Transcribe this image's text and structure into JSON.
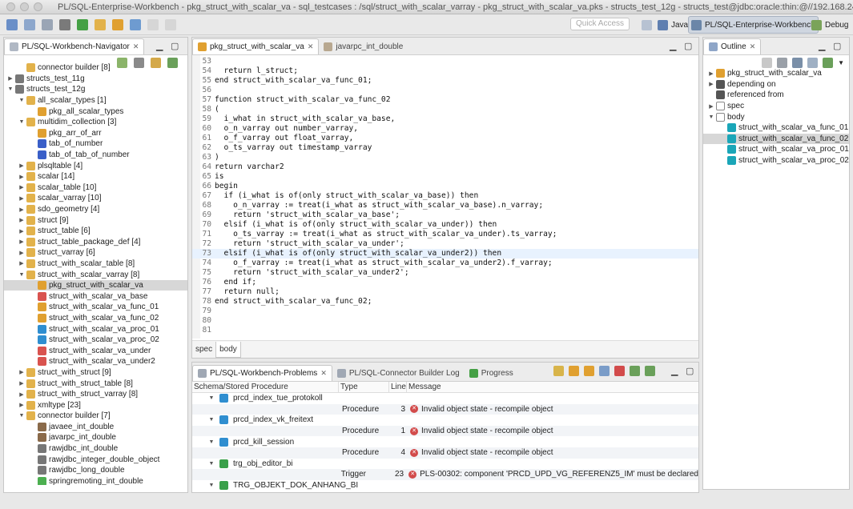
{
  "window": {
    "title": "PL/SQL-Enterprise-Workbench - pkg_struct_with_scalar_va - sql_testcases : /sql/struct_with_scalar_varray - pkg_struct_with_scalar_va.pks - structs_test_12g - structs_test@jdbc:oracle:thin:@//192.168.243..."
  },
  "toolbar": {
    "quick_access": "Quick Access",
    "perspectives": [
      {
        "label": "Java"
      },
      {
        "label": "PL/SQL-Enterprise-Workbench"
      },
      {
        "label": "Debug"
      }
    ]
  },
  "navigator": {
    "title": "PL/SQL-Workbench-Navigator",
    "rows": [
      {
        "label": "connector builder [8]",
        "indent": 2,
        "twisty": "",
        "icon": "folder-icon",
        "color": "#e2b24b"
      },
      {
        "label": "structs_test_11g",
        "indent": 1,
        "twisty": "▶",
        "icon": "database-icon",
        "color": "#777777"
      },
      {
        "label": "structs_test_12g",
        "indent": 1,
        "twisty": "▼",
        "icon": "database-icon",
        "color": "#777777"
      },
      {
        "label": "all_scalar_types [1]",
        "indent": 2,
        "twisty": "▼",
        "icon": "folder-icon",
        "color": "#e2b24b"
      },
      {
        "label": "pkg_all_scalar_types",
        "indent": 3,
        "twisty": "",
        "icon": "package-icon",
        "color": "#e0a030"
      },
      {
        "label": "multidim_collection [3]",
        "indent": 2,
        "twisty": "▼",
        "icon": "folder-icon",
        "color": "#e2b24b"
      },
      {
        "label": "pkg_arr_of_arr",
        "indent": 3,
        "twisty": "",
        "icon": "package-icon",
        "color": "#e0a030"
      },
      {
        "label": "tab_of_number",
        "indent": 3,
        "twisty": "",
        "icon": "type-icon",
        "color": "#3a5fc8"
      },
      {
        "label": "tab_of_tab_of_number",
        "indent": 3,
        "twisty": "",
        "icon": "type-icon",
        "color": "#3a5fc8"
      },
      {
        "label": "plsqltable [4]",
        "indent": 2,
        "twisty": "▶",
        "icon": "folder-icon",
        "color": "#e2b24b"
      },
      {
        "label": "scalar [14]",
        "indent": 2,
        "twisty": "▶",
        "icon": "folder-icon",
        "color": "#e2b24b"
      },
      {
        "label": "scalar_table [10]",
        "indent": 2,
        "twisty": "▶",
        "icon": "folder-icon",
        "color": "#e2b24b"
      },
      {
        "label": "scalar_varray [10]",
        "indent": 2,
        "twisty": "▶",
        "icon": "folder-icon",
        "color": "#e2b24b"
      },
      {
        "label": "sdo_geometry [4]",
        "indent": 2,
        "twisty": "▶",
        "icon": "folder-icon",
        "color": "#e2b24b"
      },
      {
        "label": "struct [9]",
        "indent": 2,
        "twisty": "▶",
        "icon": "folder-icon",
        "color": "#e2b24b"
      },
      {
        "label": "struct_table [6]",
        "indent": 2,
        "twisty": "▶",
        "icon": "folder-icon",
        "color": "#e2b24b"
      },
      {
        "label": "struct_table_package_def [4]",
        "indent": 2,
        "twisty": "▶",
        "icon": "folder-icon",
        "color": "#e2b24b"
      },
      {
        "label": "struct_varray [6]",
        "indent": 2,
        "twisty": "▶",
        "icon": "folder-icon",
        "color": "#e2b24b"
      },
      {
        "label": "struct_with_scalar_table [8]",
        "indent": 2,
        "twisty": "▶",
        "icon": "folder-icon",
        "color": "#e2b24b"
      },
      {
        "label": "struct_with_scalar_varray [8]",
        "indent": 2,
        "twisty": "▼",
        "icon": "folder-icon",
        "color": "#e2b24b"
      },
      {
        "label": "pkg_struct_with_scalar_va",
        "indent": 3,
        "twisty": "",
        "icon": "package-icon",
        "color": "#e0a030",
        "selected": true
      },
      {
        "label": "struct_with_scalar_va_base",
        "indent": 3,
        "twisty": "",
        "icon": "object-type-icon",
        "color": "#d9534f"
      },
      {
        "label": "struct_with_scalar_va_func_01",
        "indent": 3,
        "twisty": "",
        "icon": "function-icon",
        "color": "#e0a030"
      },
      {
        "label": "struct_with_scalar_va_func_02",
        "indent": 3,
        "twisty": "",
        "icon": "function-icon",
        "color": "#e0a030"
      },
      {
        "label": "struct_with_scalar_va_proc_01",
        "indent": 3,
        "twisty": "",
        "icon": "procedure-icon",
        "color": "#2f8ed0"
      },
      {
        "label": "struct_with_scalar_va_proc_02",
        "indent": 3,
        "twisty": "",
        "icon": "procedure-icon",
        "color": "#2f8ed0"
      },
      {
        "label": "struct_with_scalar_va_under",
        "indent": 3,
        "twisty": "",
        "icon": "object-type-icon",
        "color": "#d9534f"
      },
      {
        "label": "struct_with_scalar_va_under2",
        "indent": 3,
        "twisty": "",
        "icon": "object-type-icon",
        "color": "#d9534f"
      },
      {
        "label": "struct_with_struct [9]",
        "indent": 2,
        "twisty": "▶",
        "icon": "folder-icon",
        "color": "#e2b24b"
      },
      {
        "label": "struct_with_struct_table [8]",
        "indent": 2,
        "twisty": "▶",
        "icon": "folder-icon",
        "color": "#e2b24b"
      },
      {
        "label": "struct_with_struct_varray [8]",
        "indent": 2,
        "twisty": "▶",
        "icon": "folder-icon",
        "color": "#e2b24b"
      },
      {
        "label": "xmltype [23]",
        "indent": 2,
        "twisty": "▶",
        "icon": "folder-icon",
        "color": "#e2b24b"
      },
      {
        "label": "connector builder [7]",
        "indent": 2,
        "twisty": "▼",
        "icon": "folder-icon",
        "color": "#e2b24b"
      },
      {
        "label": "javaee_int_double",
        "indent": 3,
        "twisty": "",
        "icon": "connector-icon",
        "color": "#8a6a4a"
      },
      {
        "label": "javarpc_int_double",
        "indent": 3,
        "twisty": "",
        "icon": "connector-icon",
        "color": "#8a6a4a"
      },
      {
        "label": "rawjdbc_int_double",
        "indent": 3,
        "twisty": "",
        "icon": "connector-icon",
        "color": "#777777"
      },
      {
        "label": "rawjdbc_integer_double_object",
        "indent": 3,
        "twisty": "",
        "icon": "connector-icon",
        "color": "#777777"
      },
      {
        "label": "rawjdbc_long_double",
        "indent": 3,
        "twisty": "",
        "icon": "connector-icon",
        "color": "#777777"
      },
      {
        "label": "springremoting_int_double",
        "indent": 3,
        "twisty": "",
        "icon": "connector-icon",
        "color": "#4caf50"
      }
    ]
  },
  "editor": {
    "tabs": [
      {
        "label": "pkg_struct_with_scalar_va",
        "active": true
      },
      {
        "label": "javarpc_int_double",
        "active": false
      }
    ],
    "bottom_tabs": [
      {
        "label": "spec"
      },
      {
        "label": "body"
      }
    ],
    "lines": [
      {
        "n": "53",
        "t": ""
      },
      {
        "n": "54",
        "t": "  return l_struct;"
      },
      {
        "n": "55",
        "t": "end struct_with_scalar_va_func_01;"
      },
      {
        "n": "56",
        "t": ""
      },
      {
        "n": "57",
        "t": "function struct_with_scalar_va_func_02"
      },
      {
        "n": "58",
        "t": "("
      },
      {
        "n": "59",
        "t": "  i_what in struct_with_scalar_va_base,"
      },
      {
        "n": "60",
        "t": "  o_n_varray out number_varray,"
      },
      {
        "n": "61",
        "t": "  o_f_varray out float_varray,"
      },
      {
        "n": "62",
        "t": "  o_ts_varray out timestamp_varray"
      },
      {
        "n": "63",
        "t": ")"
      },
      {
        "n": "64",
        "t": "return varchar2"
      },
      {
        "n": "65",
        "t": "is"
      },
      {
        "n": "66",
        "t": "begin"
      },
      {
        "n": "67",
        "t": "  if (i_what is of(only struct_with_scalar_va_base)) then"
      },
      {
        "n": "68",
        "t": "    o_n_varray := treat(i_what as struct_with_scalar_va_base).n_varray;"
      },
      {
        "n": "69",
        "t": "    return 'struct_with_scalar_va_base';"
      },
      {
        "n": "70",
        "t": "  elsif (i_what is of(only struct_with_scalar_va_under)) then"
      },
      {
        "n": "71",
        "t": "    o_ts_varray := treat(i_what as struct_with_scalar_va_under).ts_varray;"
      },
      {
        "n": "72",
        "t": "    return 'struct_with_scalar_va_under';"
      },
      {
        "n": "73",
        "t": "  elsif (i_what is of(only struct_with_scalar_va_under2)) then"
      },
      {
        "n": "74",
        "t": "    o_f_varray := treat(i_what as struct_with_scalar_va_under2).f_varray;"
      },
      {
        "n": "75",
        "t": "    return 'struct_with_scalar_va_under2';"
      },
      {
        "n": "76",
        "t": "  end if;"
      },
      {
        "n": "77",
        "t": "  return null;"
      },
      {
        "n": "78",
        "t": "end struct_with_scalar_va_func_02;"
      },
      {
        "n": "79",
        "t": ""
      },
      {
        "n": "80",
        "t": ""
      },
      {
        "n": "81",
        "t": ""
      }
    ]
  },
  "outline": {
    "title": "Outline",
    "rows": [
      {
        "label": "pkg_struct_with_scalar_va",
        "indent": 1,
        "twisty": "▶",
        "icon": "package-icon",
        "color": "#e0a030"
      },
      {
        "label": "depending on",
        "indent": 1,
        "twisty": "▶",
        "icon": "dependency-icon",
        "color": "#555555"
      },
      {
        "label": "referenced from",
        "indent": 1,
        "twisty": "",
        "icon": "reference-icon",
        "color": "#555555"
      },
      {
        "label": "spec",
        "indent": 1,
        "twisty": "▶",
        "icon": "spec-icon",
        "color": "#ffffff"
      },
      {
        "label": "body",
        "indent": 1,
        "twisty": "▼",
        "icon": "body-icon",
        "color": "#ffffff"
      },
      {
        "label": "struct_with_scalar_va_func_01",
        "indent": 2,
        "twisty": "",
        "icon": "public-member-icon",
        "color": "#1aa6b8"
      },
      {
        "label": "struct_with_scalar_va_func_02",
        "indent": 2,
        "twisty": "",
        "icon": "public-member-icon",
        "color": "#1aa6b8",
        "selected": true
      },
      {
        "label": "struct_with_scalar_va_proc_01",
        "indent": 2,
        "twisty": "",
        "icon": "public-member-icon",
        "color": "#1aa6b8"
      },
      {
        "label": "struct_with_scalar_va_proc_02",
        "indent": 2,
        "twisty": "",
        "icon": "public-member-icon",
        "color": "#1aa6b8"
      }
    ]
  },
  "problems": {
    "tabs": [
      {
        "label": "PL/SQL-Workbench-Problems"
      },
      {
        "label": "PL/SQL-Connector Builder Log"
      },
      {
        "label": "Progress"
      }
    ],
    "columns": [
      "Schema/Stored Procedure",
      "Type",
      "Line",
      "Message"
    ],
    "rows": [
      {
        "name": "prcd_index_tue_protokoll",
        "group": true,
        "icon_color": "#2f8ed0"
      },
      {
        "type": "Procedure",
        "line": "3",
        "message": "Invalid object state - recompile object"
      },
      {
        "name": "prcd_index_vk_freitext",
        "group": true,
        "icon_color": "#2f8ed0"
      },
      {
        "type": "Procedure",
        "line": "1",
        "message": "Invalid object state - recompile object"
      },
      {
        "name": "prcd_kill_session",
        "group": true,
        "icon_color": "#2f8ed0"
      },
      {
        "type": "Procedure",
        "line": "4",
        "message": "Invalid object state - recompile object"
      },
      {
        "name": "trg_obj_editor_bi",
        "group": true,
        "icon_color": "#3aa04a"
      },
      {
        "type": "Trigger",
        "line": "23",
        "message": "PLS-00302: component 'PRCD_UPD_VG_REFERENZ5_IM' must be declared"
      },
      {
        "name": "TRG_OBJEKT_DOK_ANHANG_BI",
        "group": true,
        "icon_color": "#3aa04a"
      }
    ]
  }
}
